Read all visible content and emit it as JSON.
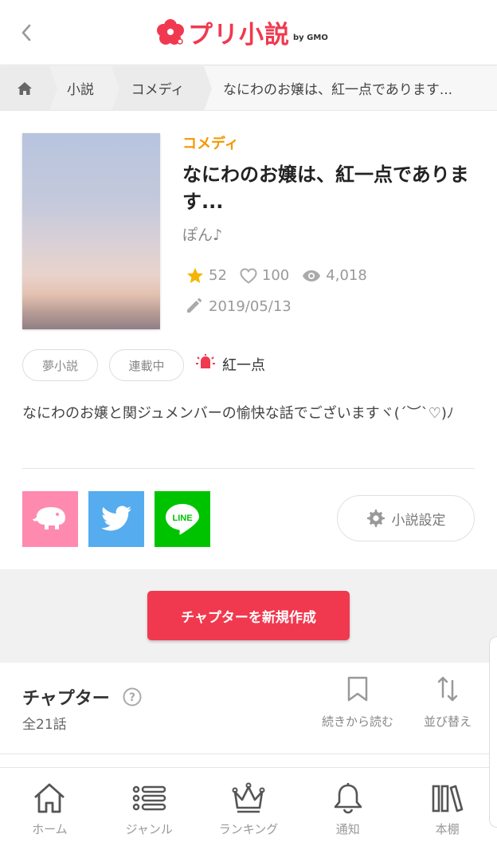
{
  "header": {
    "logo_text": "プリ小説",
    "logo_by": "by GMO"
  },
  "breadcrumb": {
    "items": [
      "小説",
      "コメディ",
      "なにわのお嬢は、紅一点であります..."
    ]
  },
  "novel": {
    "genre": "コメディ",
    "title": "なにわのお嬢は、紅一点であります...",
    "author": "ぽん♪",
    "stars": "52",
    "likes": "100",
    "views": "4,018",
    "updated": "2019/05/13",
    "tags": [
      "夢小説",
      "連載中"
    ],
    "pin_tag": "紅一点",
    "description": "なにわのお嬢と関ジュメンバーの愉快な話でございますヾ(´︶`♡)ﾉ"
  },
  "actions": {
    "settings_label": "小説設定",
    "create_chapter_label": "チャプターを新規作成"
  },
  "chapters": {
    "title": "チャプター",
    "count": "全21話",
    "resume_label": "続きから読む",
    "sort_label": "並び替え"
  },
  "bottom_nav": {
    "items": [
      "ホーム",
      "ジャンル",
      "ランキング",
      "通知",
      "本棚"
    ]
  },
  "colors": {
    "brand": "#f0394f",
    "genre": "#f39800",
    "star": "#f5b400",
    "pin": "#f0394f"
  }
}
